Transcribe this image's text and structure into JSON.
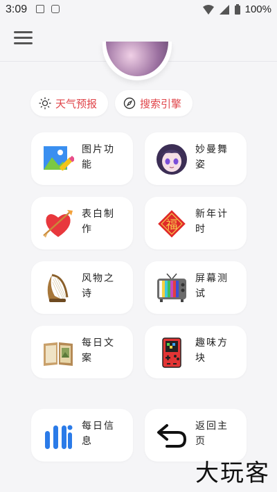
{
  "status": {
    "time": "3:09",
    "battery": "100%"
  },
  "pills": [
    {
      "label": "天气预报",
      "icon": "sun-icon"
    },
    {
      "label": "搜索引擎",
      "icon": "compass-icon"
    }
  ],
  "cards": [
    {
      "label": "图片功能",
      "icon": "image-edit-icon"
    },
    {
      "label": "妙曼舞姿",
      "icon": "anime-girl-icon"
    },
    {
      "label": "表白制作",
      "icon": "heart-arrow-icon"
    },
    {
      "label": "新年计时",
      "icon": "fu-character-icon"
    },
    {
      "label": "风物之诗",
      "icon": "lyre-icon"
    },
    {
      "label": "屏幕测试",
      "icon": "retro-tv-icon"
    },
    {
      "label": "每日文案",
      "icon": "open-book-icon"
    },
    {
      "label": "趣味方块",
      "icon": "game-console-icon"
    },
    {
      "label": "每日信息",
      "icon": "info-bars-icon"
    },
    {
      "label": "返回主页",
      "icon": "return-arrow-icon"
    }
  ],
  "watermark": "大玩客",
  "colors": {
    "accent": "#e0454a",
    "background": "#f5f5f7"
  }
}
